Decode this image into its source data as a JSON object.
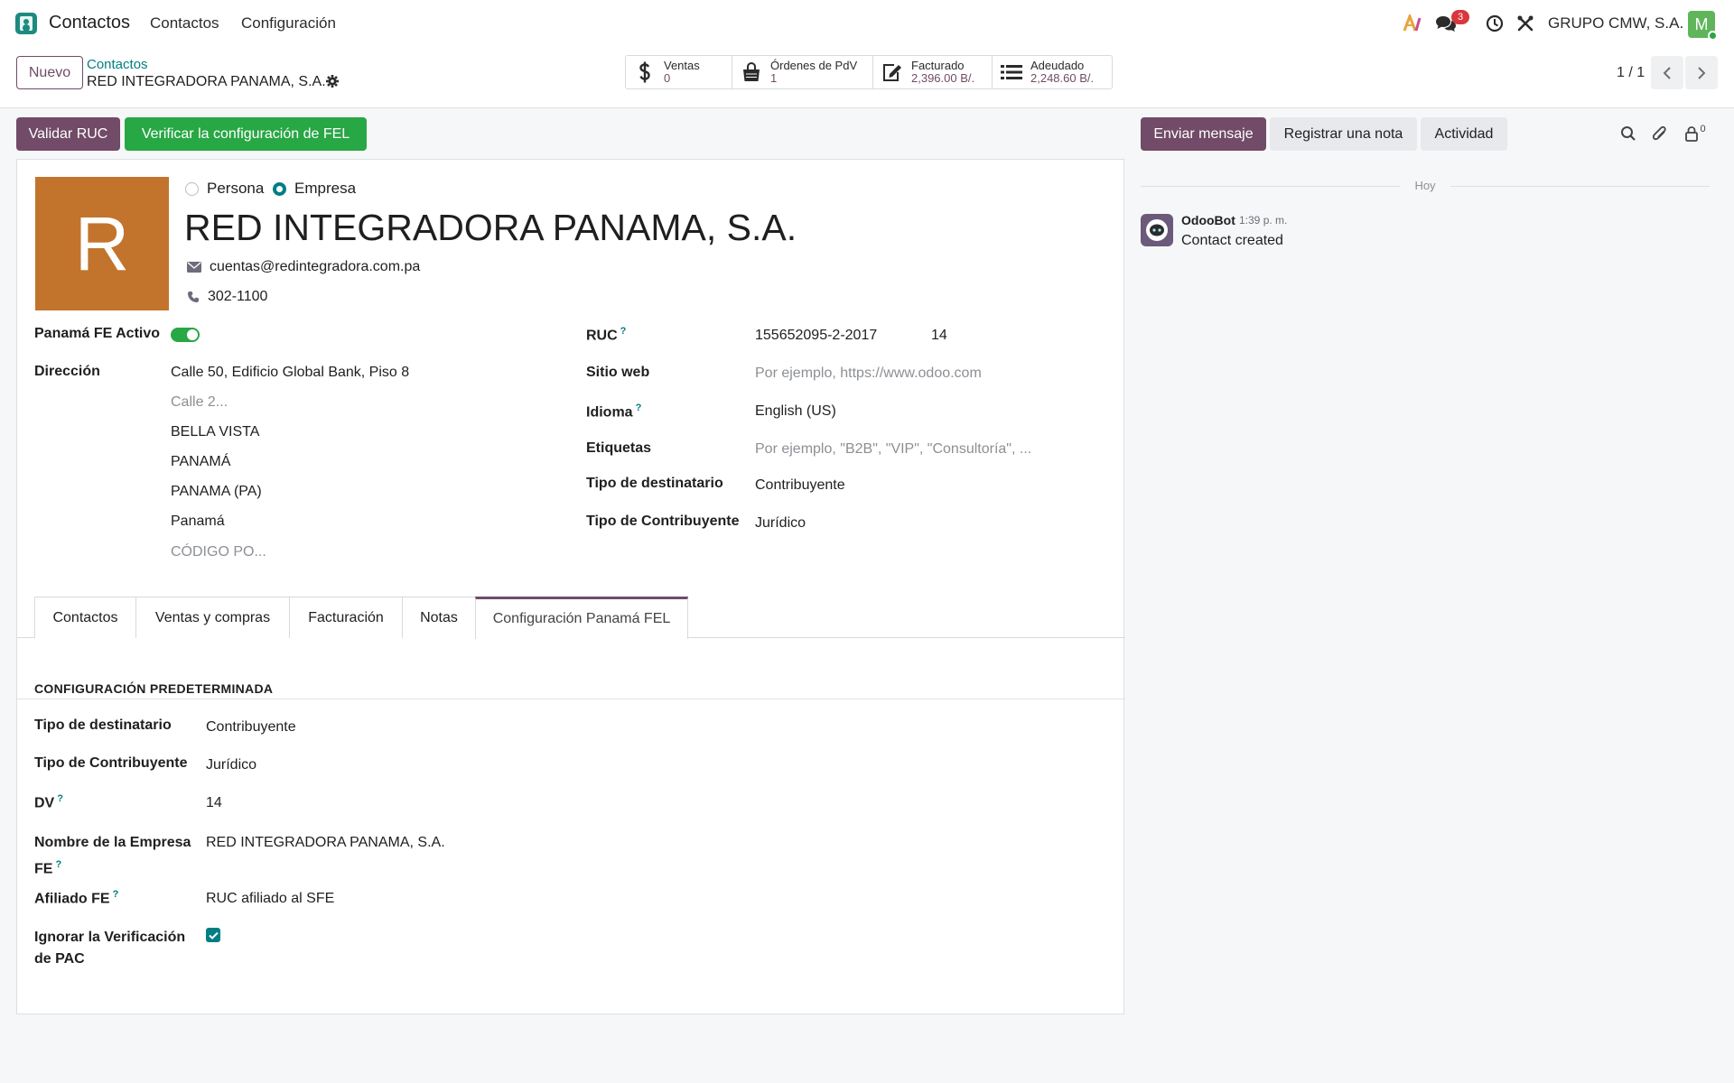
{
  "navbar": {
    "brand": "Contactos",
    "menu": [
      "Contactos",
      "Configuración"
    ],
    "messages_badge": "3",
    "company": "GRUPO CMW, S.A.",
    "user_initial": "M"
  },
  "control": {
    "new_label": "Nuevo",
    "breadcrumb_parent": "Contactos",
    "breadcrumb_current": "RED INTEGRADORA PANAMA, S.A.",
    "pager": "1 / 1",
    "smart_buttons": [
      {
        "label": "Ventas",
        "value": "0",
        "icon": "dollar-icon"
      },
      {
        "label": "Órdenes de PdV",
        "value": "1",
        "icon": "shopping-bag-icon"
      },
      {
        "label": "Facturado",
        "value": "2,396.00 B/.",
        "icon": "pencil-square-icon"
      },
      {
        "label": "Adeudado",
        "value": "2,248.60 B/.",
        "icon": "list-icon"
      }
    ]
  },
  "actions": {
    "validar_ruc": "Validar RUC",
    "verificar_fel": "Verificar la configuración de FEL",
    "enviar_mensaje": "Enviar mensaje",
    "registrar_nota": "Registrar una nota",
    "actividad": "Actividad",
    "followers_count": "0"
  },
  "form": {
    "avatar_letter": "R",
    "company_type": {
      "persona": "Persona",
      "empresa": "Empresa",
      "selected": "Empresa"
    },
    "name": "RED INTEGRADORA PANAMA, S.A.",
    "email": "cuentas@redintegradora.com.pa",
    "phone": "302-1100",
    "panama_fe_label": "Panamá FE Activo",
    "direccion_label": "Dirección",
    "address": {
      "street": "Calle 50, Edificio Global Bank, Piso 8",
      "street2_placeholder": "Calle 2...",
      "district": "BELLA VISTA",
      "city": "PANAMÁ",
      "state": "PANAMA (PA)",
      "country": "Panamá",
      "zip_placeholder": "CÓDIGO PO..."
    },
    "ruc_label": "RUC",
    "ruc": "155652095-2-2017",
    "ruc_dv": "14",
    "website_label": "Sitio web",
    "website_placeholder": "Por ejemplo, https://www.odoo.com",
    "idioma_label": "Idioma",
    "idioma": "English (US)",
    "etiquetas_label": "Etiquetas",
    "etiquetas_placeholder": "Por ejemplo, \"B2B\", \"VIP\", \"Consultoría\", ...",
    "tipo_dest_label": "Tipo de destinatario",
    "tipo_dest": "Contribuyente",
    "tipo_contrib_label": "Tipo de Contribuyente",
    "tipo_contrib": "Jurídico"
  },
  "tabs": [
    "Contactos",
    "Ventas y compras",
    "Facturación",
    "Notas",
    "Configuración Panamá FEL"
  ],
  "active_tab": "Configuración Panamá FEL",
  "fel": {
    "section_title": "CONFIGURACIÓN PREDETERMINADA",
    "tipo_dest_label": "Tipo de destinatario",
    "tipo_dest": "Contribuyente",
    "tipo_contrib_label": "Tipo de Contribuyente",
    "tipo_contrib": "Jurídico",
    "dv_label": "DV",
    "dv": "14",
    "nombre_label_1": "Nombre de la Empresa",
    "nombre_label_2": "FE",
    "nombre": "RED INTEGRADORA PANAMA, S.A.",
    "afiliado_label": "Afiliado FE",
    "afiliado": "RUC afiliado al SFE",
    "ignorar_label_1": "Ignorar la Verificación",
    "ignorar_label_2": "de PAC",
    "ignorar_checked": true
  },
  "chatter": {
    "day": "Hoy",
    "author": "OdooBot",
    "time": "1:39 p. m.",
    "message": "Contact created"
  },
  "colors": {
    "primary": "#714b67",
    "success": "#28a745",
    "teal": "#017e84",
    "avatar": "#c2742c"
  }
}
